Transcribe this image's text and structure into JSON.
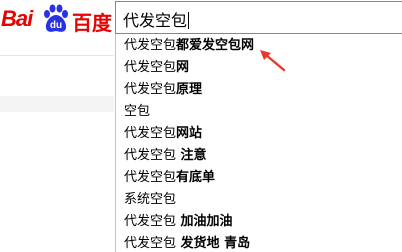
{
  "logo": {
    "left_text": "Bai",
    "paw_text": "du",
    "right_text": "百度",
    "brand_color": "#e10602",
    "paw_color": "#2932e1"
  },
  "search": {
    "value": "代发空包",
    "border_color": "#4791ff"
  },
  "suggestions": [
    {
      "prefix": "代发空包",
      "suffix": "都爱发空包网"
    },
    {
      "prefix": "代发空包",
      "suffix": "网"
    },
    {
      "prefix": "代发空包",
      "suffix": "原理"
    },
    {
      "prefix": "空包",
      "suffix": ""
    },
    {
      "prefix": "代发空包",
      "suffix": "网站"
    },
    {
      "prefix": "代发空包",
      "suffix": " 注意"
    },
    {
      "prefix": "代发空包",
      "suffix": "有底单"
    },
    {
      "prefix": "系统空包",
      "suffix": ""
    },
    {
      "prefix": "代发空包",
      "suffix": " 加油加油"
    },
    {
      "prefix": "代发空包",
      "suffix": " 发货地 青岛"
    }
  ],
  "annotation": {
    "arrow_color": "#e8372c",
    "arrow_icon": "red-arrow-icon"
  }
}
